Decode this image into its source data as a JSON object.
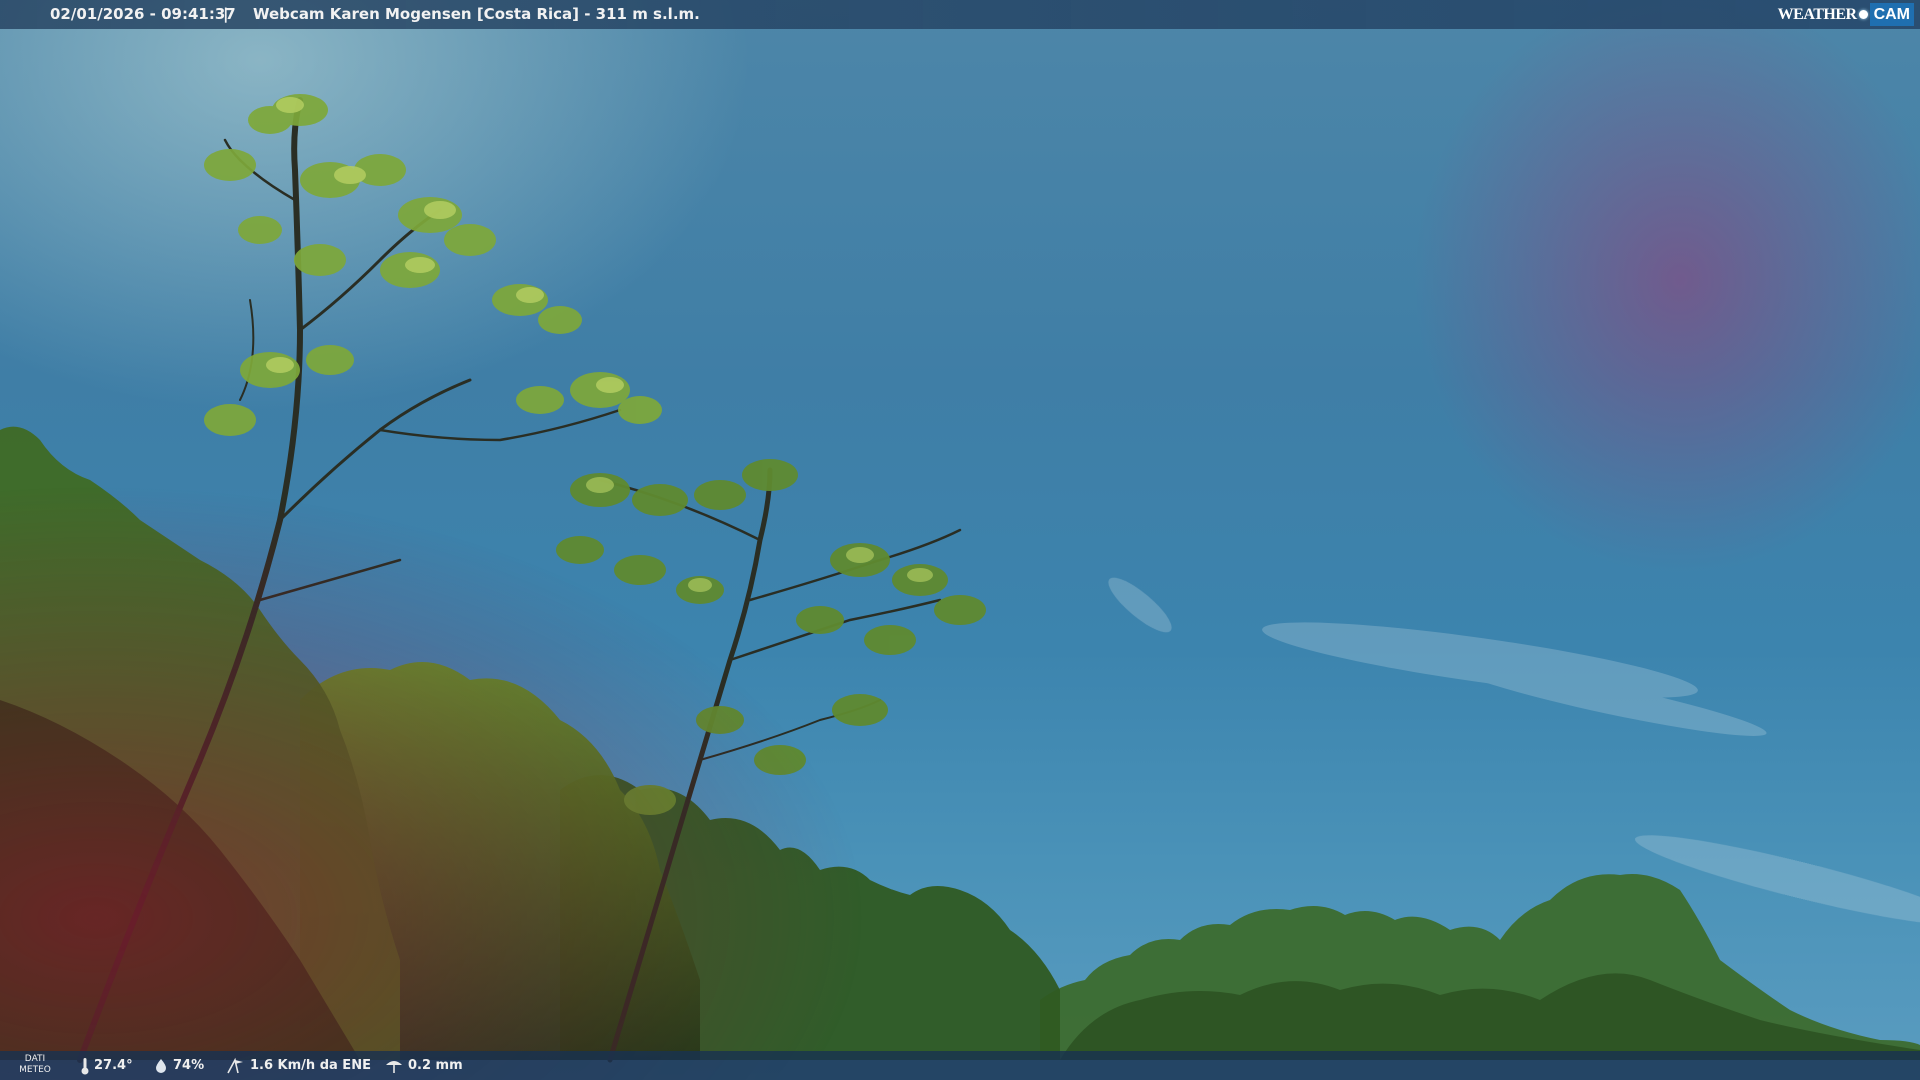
{
  "header": {
    "timestamp": "02/01/2026 - 09:41:37",
    "separator": "|",
    "title": "Webcam Karen Mogensen [Costa Rica] - 311 m s.l.m."
  },
  "brand": {
    "left": "WEATHER",
    "right": "CAM",
    "accent": "#1f6fb0"
  },
  "meteo": {
    "label_line1": "DATI",
    "label_line2": "METEO",
    "temperature": "27.4°",
    "humidity": "74%",
    "wind": "1.6 Km/h da ENE",
    "rain": "0.2 mm",
    "icons": {
      "temperature": "thermometer-icon",
      "humidity": "droplet-icon",
      "wind": "wind-icon",
      "rain": "rain-gauge-icon"
    }
  }
}
